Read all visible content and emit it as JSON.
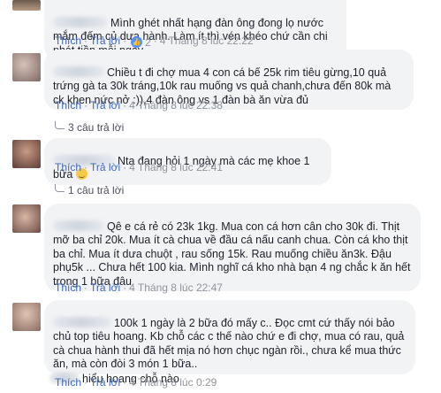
{
  "comments": [
    {
      "text": "Mình ghét nhất hạng đàn ông đong lọ nước mắm đếm củ dưa hành. Làm ít thì vén khéo chứ cần chi phát tiền mỗi ngày.",
      "like": "Thích",
      "reply": "Trả lời",
      "reactions": "2",
      "time": "4 Tháng 8 lúc 22:22"
    },
    {
      "text": "Chiều t đi chợ mua 4 con cá bế 25k rim tiêu gừng,10 quả trứng gà ta 30k tráng,10k rau muống vs quả chanh,chưa đến 80k mà ck khen nức nở :)),4 đàn ông vs 1 đàn bà ăn vừa đủ",
      "like": "Thích",
      "reply": "Trả lời",
      "reactions": "",
      "time": "4 Tháng 8 lúc 22:38",
      "replies": "3 câu trả lời"
    },
    {
      "text": "Nta đang hỏi 1 ngày mà các mẹ khoe 1 bữa",
      "emoji": "smile-emoji",
      "like": "Thích",
      "reply": "Trả lời",
      "reactions": "",
      "time": "4 Tháng 8 lúc 22:41",
      "replies": "1 câu trả lời"
    },
    {
      "text": "Qê e cá rẻ có 23k 1kg. Mua con cá hơn cân cho 30k đi. Thịt mỡ ba chỉ 20k. Mua ít cà chua về đầu cá nấu canh chua. Còn cá kho thịt ba chỉ. Mua ít dưa chuột , rau sống 15k. Rau muống chiều ăn3k. Đậu phụ5k ... Chưa hết 100 kia. Mình nghĩ cá kho nhà bạn 4 ng chắc k ăn hết trong 1 bữa đâu",
      "like": "Thích",
      "reply": "Trả lời",
      "reactions": "",
      "time": "4 Tháng 8 lúc 22:47"
    },
    {
      "text": "100k 1 ngày là 2 bữa đó mấy c.. Đọc cmt cứ thấy nói bảo chủ top tiêu hoang. Kb chỗ các c thế nào chứ e đi chợ, mua có rau, quả cà chua hành thui đã hết mịa nó hơn chục ngàn rồi., chưa kể mua thức ăn, mà còn đòi 3 món 1 bữa.."
    },
    {
      "text": "hiểu hoang chỗ nào",
      "like": "Thích",
      "reply": "Trả lời",
      "reactions": "",
      "time": "4 Tháng 8 lúc 0:29"
    }
  ],
  "colors": {
    "link": "#4267b2",
    "meta": "#90949c",
    "bubble": "#f2f3f5",
    "like": "#5890ff"
  }
}
